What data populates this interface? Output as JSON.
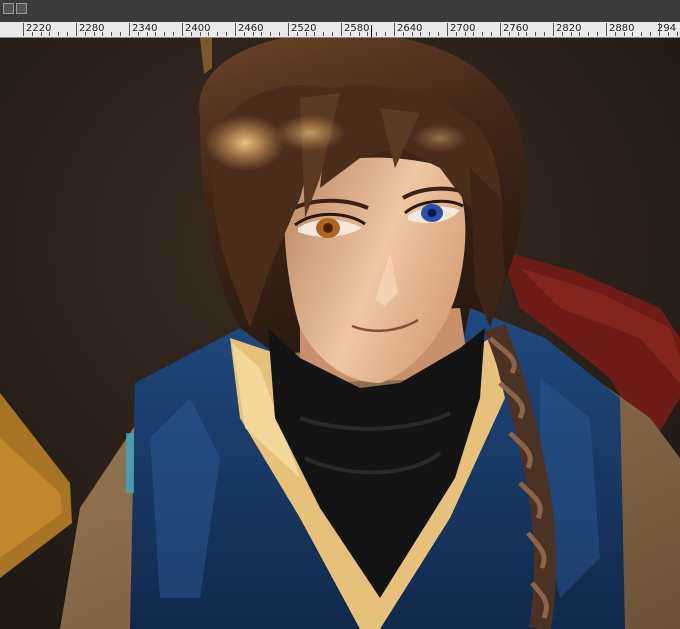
{
  "ruler": {
    "ticks": [
      "2220",
      "2280",
      "2340",
      "2400",
      "2460",
      "2520",
      "2580",
      "2640",
      "2700",
      "2760",
      "2820",
      "2880",
      "294"
    ]
  },
  "colors": {
    "toolbar_bg": "#3b3b3b",
    "ruler_bg": "#e9e9e9",
    "canvas_bg": "#2a221b",
    "hair": "#4a3020",
    "skin": "#e8bd98",
    "robe_blue": "#173a66",
    "collar_cream": "#e7c07a",
    "scarf_black": "#141414",
    "eye_left": "#b0651e",
    "eye_right": "#2d4fb3"
  },
  "icons": [
    "toolbar-icon",
    "toolbar-icon"
  ]
}
